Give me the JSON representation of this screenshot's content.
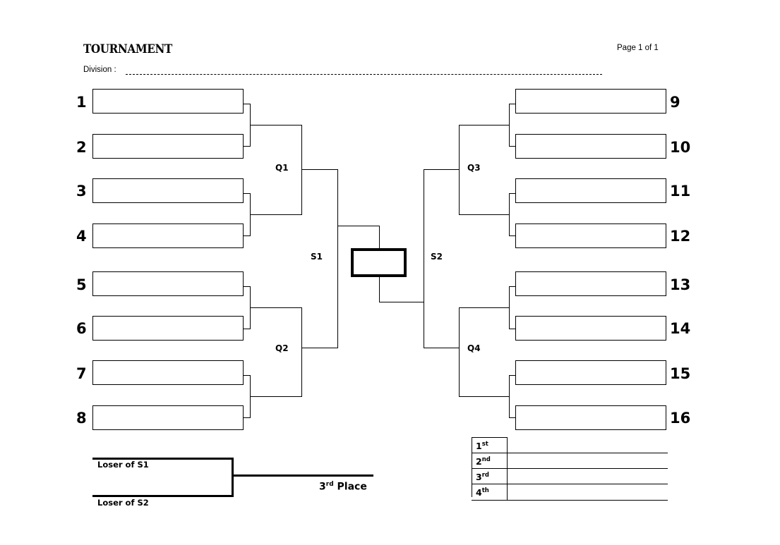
{
  "header": {
    "title": "TOURNAMENT",
    "page_of": "Page 1 of 1",
    "division_label": "Division :"
  },
  "bracket": {
    "left_seeds": [
      "1",
      "2",
      "3",
      "4",
      "5",
      "6",
      "7",
      "8"
    ],
    "right_seeds": [
      "9",
      "10",
      "11",
      "12",
      "13",
      "14",
      "15",
      "16"
    ],
    "round_labels": {
      "q1": "Q1",
      "q2": "Q2",
      "q3": "Q3",
      "q4": "Q4",
      "s1": "S1",
      "s2": "S2"
    }
  },
  "third_place": {
    "loser_s1": "Loser of  S1",
    "loser_s2": "Loser of  S2",
    "place_number": "3",
    "place_suffix": "rd",
    "place_word": "Place"
  },
  "results": {
    "rows": [
      {
        "number": "1",
        "suffix": "st",
        "value": ""
      },
      {
        "number": "2",
        "suffix": "nd",
        "value": ""
      },
      {
        "number": "3",
        "suffix": "rd",
        "value": ""
      },
      {
        "number": "4",
        "suffix": "th",
        "value": ""
      }
    ]
  },
  "colors": {
    "ink": "#000000",
    "paper": "#ffffff"
  }
}
